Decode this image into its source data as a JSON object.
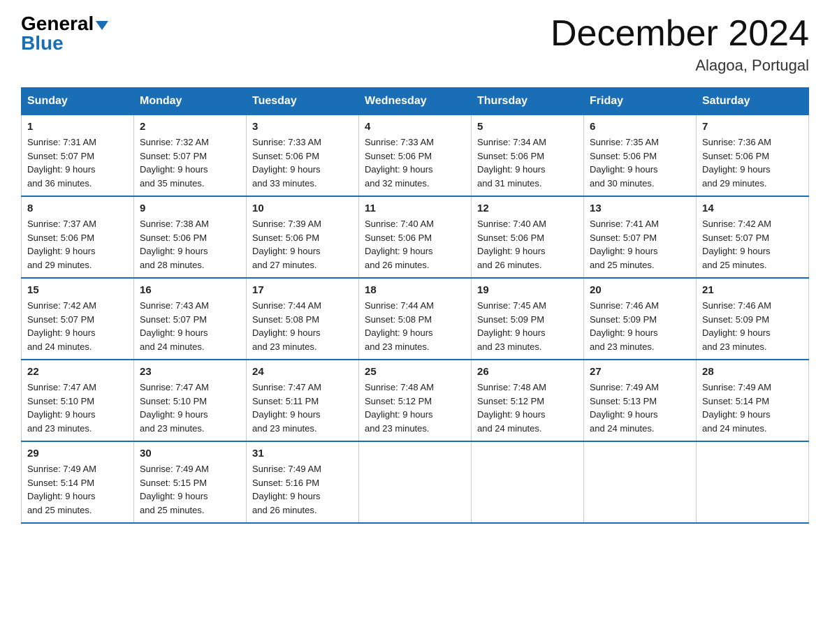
{
  "header": {
    "logo_general": "General",
    "logo_blue": "Blue",
    "month_title": "December 2024",
    "location": "Alagoa, Portugal"
  },
  "days_of_week": [
    "Sunday",
    "Monday",
    "Tuesday",
    "Wednesday",
    "Thursday",
    "Friday",
    "Saturday"
  ],
  "weeks": [
    [
      {
        "day": "1",
        "sunrise": "7:31 AM",
        "sunset": "5:07 PM",
        "daylight": "9 hours and 36 minutes."
      },
      {
        "day": "2",
        "sunrise": "7:32 AM",
        "sunset": "5:07 PM",
        "daylight": "9 hours and 35 minutes."
      },
      {
        "day": "3",
        "sunrise": "7:33 AM",
        "sunset": "5:06 PM",
        "daylight": "9 hours and 33 minutes."
      },
      {
        "day": "4",
        "sunrise": "7:33 AM",
        "sunset": "5:06 PM",
        "daylight": "9 hours and 32 minutes."
      },
      {
        "day": "5",
        "sunrise": "7:34 AM",
        "sunset": "5:06 PM",
        "daylight": "9 hours and 31 minutes."
      },
      {
        "day": "6",
        "sunrise": "7:35 AM",
        "sunset": "5:06 PM",
        "daylight": "9 hours and 30 minutes."
      },
      {
        "day": "7",
        "sunrise": "7:36 AM",
        "sunset": "5:06 PM",
        "daylight": "9 hours and 29 minutes."
      }
    ],
    [
      {
        "day": "8",
        "sunrise": "7:37 AM",
        "sunset": "5:06 PM",
        "daylight": "9 hours and 29 minutes."
      },
      {
        "day": "9",
        "sunrise": "7:38 AM",
        "sunset": "5:06 PM",
        "daylight": "9 hours and 28 minutes."
      },
      {
        "day": "10",
        "sunrise": "7:39 AM",
        "sunset": "5:06 PM",
        "daylight": "9 hours and 27 minutes."
      },
      {
        "day": "11",
        "sunrise": "7:40 AM",
        "sunset": "5:06 PM",
        "daylight": "9 hours and 26 minutes."
      },
      {
        "day": "12",
        "sunrise": "7:40 AM",
        "sunset": "5:06 PM",
        "daylight": "9 hours and 26 minutes."
      },
      {
        "day": "13",
        "sunrise": "7:41 AM",
        "sunset": "5:07 PM",
        "daylight": "9 hours and 25 minutes."
      },
      {
        "day": "14",
        "sunrise": "7:42 AM",
        "sunset": "5:07 PM",
        "daylight": "9 hours and 25 minutes."
      }
    ],
    [
      {
        "day": "15",
        "sunrise": "7:42 AM",
        "sunset": "5:07 PM",
        "daylight": "9 hours and 24 minutes."
      },
      {
        "day": "16",
        "sunrise": "7:43 AM",
        "sunset": "5:07 PM",
        "daylight": "9 hours and 24 minutes."
      },
      {
        "day": "17",
        "sunrise": "7:44 AM",
        "sunset": "5:08 PM",
        "daylight": "9 hours and 23 minutes."
      },
      {
        "day": "18",
        "sunrise": "7:44 AM",
        "sunset": "5:08 PM",
        "daylight": "9 hours and 23 minutes."
      },
      {
        "day": "19",
        "sunrise": "7:45 AM",
        "sunset": "5:09 PM",
        "daylight": "9 hours and 23 minutes."
      },
      {
        "day": "20",
        "sunrise": "7:46 AM",
        "sunset": "5:09 PM",
        "daylight": "9 hours and 23 minutes."
      },
      {
        "day": "21",
        "sunrise": "7:46 AM",
        "sunset": "5:09 PM",
        "daylight": "9 hours and 23 minutes."
      }
    ],
    [
      {
        "day": "22",
        "sunrise": "7:47 AM",
        "sunset": "5:10 PM",
        "daylight": "9 hours and 23 minutes."
      },
      {
        "day": "23",
        "sunrise": "7:47 AM",
        "sunset": "5:10 PM",
        "daylight": "9 hours and 23 minutes."
      },
      {
        "day": "24",
        "sunrise": "7:47 AM",
        "sunset": "5:11 PM",
        "daylight": "9 hours and 23 minutes."
      },
      {
        "day": "25",
        "sunrise": "7:48 AM",
        "sunset": "5:12 PM",
        "daylight": "9 hours and 23 minutes."
      },
      {
        "day": "26",
        "sunrise": "7:48 AM",
        "sunset": "5:12 PM",
        "daylight": "9 hours and 24 minutes."
      },
      {
        "day": "27",
        "sunrise": "7:49 AM",
        "sunset": "5:13 PM",
        "daylight": "9 hours and 24 minutes."
      },
      {
        "day": "28",
        "sunrise": "7:49 AM",
        "sunset": "5:14 PM",
        "daylight": "9 hours and 24 minutes."
      }
    ],
    [
      {
        "day": "29",
        "sunrise": "7:49 AM",
        "sunset": "5:14 PM",
        "daylight": "9 hours and 25 minutes."
      },
      {
        "day": "30",
        "sunrise": "7:49 AM",
        "sunset": "5:15 PM",
        "daylight": "9 hours and 25 minutes."
      },
      {
        "day": "31",
        "sunrise": "7:49 AM",
        "sunset": "5:16 PM",
        "daylight": "9 hours and 26 minutes."
      },
      null,
      null,
      null,
      null
    ]
  ],
  "labels": {
    "sunrise": "Sunrise:",
    "sunset": "Sunset:",
    "daylight": "Daylight:"
  }
}
